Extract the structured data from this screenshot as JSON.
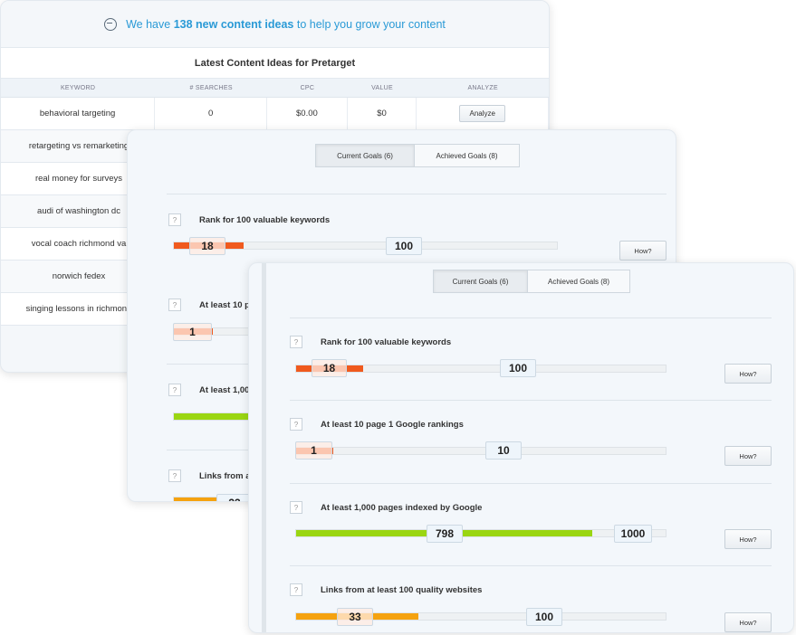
{
  "ideas": {
    "header_prefix": "We have ",
    "header_bold": "138 new content ideas",
    "header_suffix": " to help you grow your content",
    "title": "Latest Content Ideas for Pretarget",
    "columns": [
      "KEYWORD",
      "# SEARCHES",
      "CPC",
      "VALUE",
      "ANALYZE"
    ],
    "rows": [
      {
        "keyword": "behavioral targeting",
        "searches": "0",
        "cpc": "$0.00",
        "value": "$0",
        "action": "Analyze"
      },
      {
        "keyword": "retargeting vs remarketing"
      },
      {
        "keyword": "real money for surveys"
      },
      {
        "keyword": "audi of washington dc"
      },
      {
        "keyword": "vocal coach richmond va"
      },
      {
        "keyword": "norwich fedex"
      },
      {
        "keyword": "singing lessons in richmond"
      }
    ]
  },
  "goals_back": {
    "tabs": [
      "Current Goals (6)",
      "Achieved Goals (8)"
    ],
    "goals": [
      {
        "title": "Rank for 100 valuable keywords",
        "current": "18",
        "target": "100",
        "progress": 0.18,
        "color": "#f05a1e"
      },
      {
        "title": "At least 10 p",
        "current": "1",
        "target": "",
        "progress": 0.1,
        "color": "#f05a1e"
      },
      {
        "title": "At least 1,00",
        "current": "",
        "target": "",
        "progress": 0.8,
        "color": "#9ad612"
      },
      {
        "title": "Links from a",
        "current": "33",
        "target": "",
        "progress": 0.33,
        "color": "#f5a20f"
      }
    ],
    "how_label": "How?"
  },
  "goals_front": {
    "tabs": [
      "Current Goals (6)",
      "Achieved Goals (8)"
    ],
    "how_label": "How?",
    "goals": [
      {
        "title": "Rank for 100 valuable keywords",
        "current": "18",
        "target": "100",
        "progress": 0.18,
        "color": "#f05a1e"
      },
      {
        "title": "At least 10 page 1 Google rankings",
        "current": "1",
        "target": "10",
        "progress": 0.1,
        "color": "#f05a1e"
      },
      {
        "title": "At least 1,000 pages indexed by Google",
        "current": "798",
        "target": "1000",
        "progress": 0.798,
        "color": "#9ad612"
      },
      {
        "title": "Links from at least 100 quality websites",
        "current": "33",
        "target": "100",
        "progress": 0.33,
        "color": "#f5a20f"
      }
    ]
  }
}
